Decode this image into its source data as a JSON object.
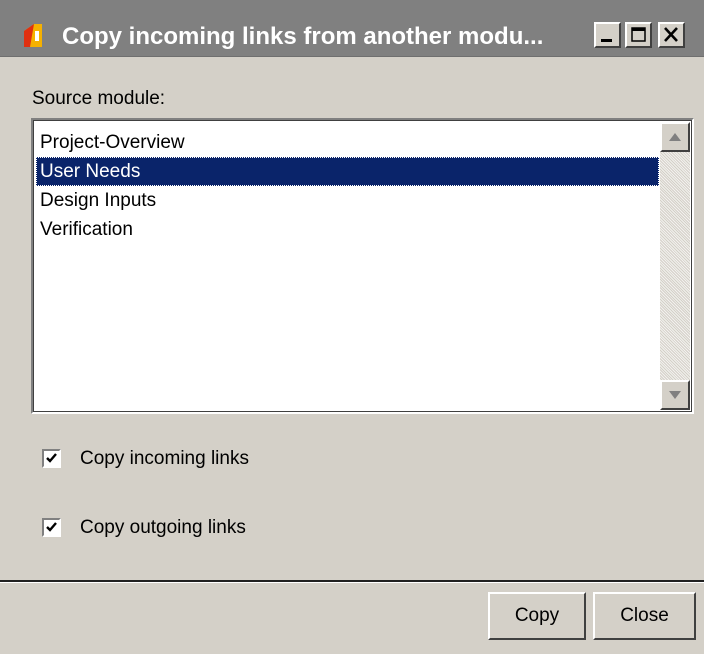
{
  "window": {
    "title": "Copy incoming links from another modu...",
    "icon": "app-logo-icon",
    "controls": {
      "minimize": "minimize-icon",
      "maximize": "maximize-icon",
      "close": "close-icon"
    }
  },
  "source": {
    "label": "Source module:",
    "items": [
      "Project-Overview",
      "User Needs",
      "Design Inputs",
      "Verification"
    ],
    "selected": "User Needs"
  },
  "options": {
    "incoming": {
      "label": "Copy incoming links",
      "checked": true
    },
    "outgoing": {
      "label": "Copy outgoing links",
      "checked": true
    }
  },
  "buttons": {
    "copy": "Copy",
    "close": "Close"
  },
  "colors": {
    "titlebar": "#808080",
    "selection": "#0a246a",
    "face": "#d4d0c8"
  }
}
